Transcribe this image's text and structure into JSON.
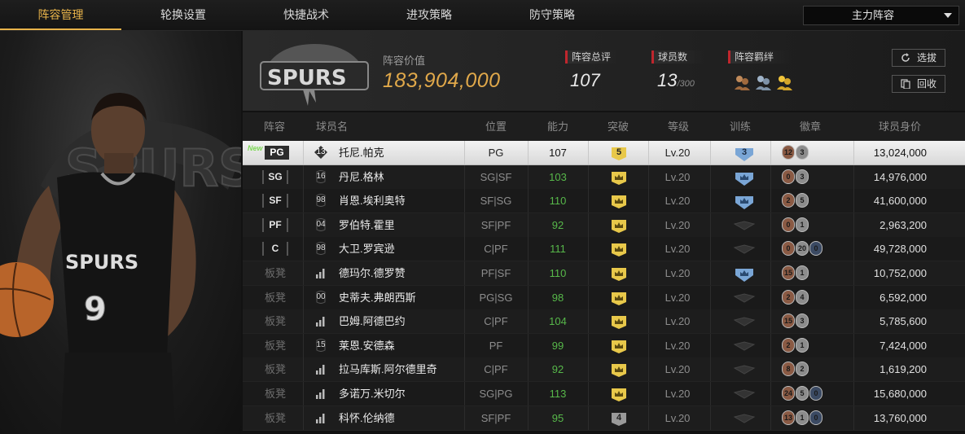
{
  "nav": {
    "tabs": [
      "阵容管理",
      "轮换设置",
      "快捷战术",
      "进攻策略",
      "防守策略"
    ],
    "active_tab": "阵容管理",
    "lineup_select": "主力阵容"
  },
  "team": {
    "logo_text": "SPURS",
    "value_label": "阵容价值",
    "value": "183,904,000",
    "rating_label": "阵容总评",
    "rating": "107",
    "player_count_label": "球员数",
    "player_count": "13",
    "player_count_max": "/300",
    "chemistry_label": "阵容羁绊",
    "chemistry_icons": [
      "chemistry-bronze-icon",
      "chemistry-silver-icon",
      "chemistry-gold-icon"
    ],
    "select_button": "选拔",
    "recycle_button": "回收"
  },
  "table": {
    "headers": [
      "阵容",
      "球员名",
      "位置",
      "能力",
      "突破",
      "等级",
      "训练",
      "徽章",
      "球员身价"
    ],
    "rows": [
      {
        "slot": "PG",
        "is_new": true,
        "new_label": "New",
        "num": "13",
        "name": "托尼.帕克",
        "pos": "PG",
        "ability": "107",
        "breakthrough": "5",
        "level": "Lv.20",
        "train": "3",
        "badges": [
          "12",
          "3"
        ],
        "price": "13,024,000"
      },
      {
        "slot": "SG",
        "num": "16",
        "name": "丹尼.格林",
        "pos": "SG|SF",
        "ability": "103",
        "breakthrough": "crown",
        "level": "Lv.20",
        "train": "crown",
        "badges": [
          "0",
          "3"
        ],
        "price": "14,976,000"
      },
      {
        "slot": "SF",
        "num": "98",
        "name": "肖恩.埃利奥特",
        "pos": "SF|SG",
        "ability": "110",
        "breakthrough": "crown",
        "level": "Lv.20",
        "train": "crown",
        "badges": [
          "2",
          "5"
        ],
        "price": "41,600,000"
      },
      {
        "slot": "PF",
        "num": "04",
        "name": "罗伯特.霍里",
        "pos": "SF|PF",
        "ability": "92",
        "breakthrough": "crown",
        "level": "Lv.20",
        "train": "none",
        "badges": [
          "0",
          "1"
        ],
        "price": "2,963,200"
      },
      {
        "slot": "C",
        "num": "98",
        "name": "大卫.罗宾逊",
        "pos": "C|PF",
        "ability": "111",
        "breakthrough": "crown",
        "level": "Lv.20",
        "train": "none",
        "badges": [
          "0",
          "20",
          "0"
        ],
        "price": "49,728,000"
      },
      {
        "slot": "板凳",
        "num": "",
        "name": "德玛尔.德罗赞",
        "pos": "PF|SF",
        "ability": "110",
        "breakthrough": "crown",
        "level": "Lv.20",
        "train": "crown",
        "badges": [
          "15",
          "1"
        ],
        "price": "10,752,000"
      },
      {
        "slot": "板凳",
        "num": "00",
        "name": "史蒂夫.弗朗西斯",
        "pos": "PG|SG",
        "ability": "98",
        "breakthrough": "crown",
        "level": "Lv.20",
        "train": "none",
        "badges": [
          "2",
          "4"
        ],
        "price": "6,592,000"
      },
      {
        "slot": "板凳",
        "num": "",
        "name": "巴姆.阿德巴约",
        "pos": "C|PF",
        "ability": "104",
        "breakthrough": "crown",
        "level": "Lv.20",
        "train": "none",
        "badges": [
          "15",
          "3"
        ],
        "price": "5,785,600"
      },
      {
        "slot": "板凳",
        "num": "15",
        "name": "莱恩.安德森",
        "pos": "PF",
        "ability": "99",
        "breakthrough": "crown",
        "level": "Lv.20",
        "train": "none",
        "badges": [
          "2",
          "1"
        ],
        "price": "7,424,000"
      },
      {
        "slot": "板凳",
        "num": "",
        "name": "拉马库斯.阿尔德里奇",
        "pos": "C|PF",
        "ability": "92",
        "breakthrough": "crown",
        "level": "Lv.20",
        "train": "none",
        "badges": [
          "8",
          "2"
        ],
        "price": "1,619,200"
      },
      {
        "slot": "板凳",
        "num": "",
        "name": "多诺万.米切尔",
        "pos": "SG|PG",
        "ability": "113",
        "breakthrough": "crown",
        "level": "Lv.20",
        "train": "none",
        "badges": [
          "24",
          "5",
          "0"
        ],
        "price": "15,680,000"
      },
      {
        "slot": "板凳",
        "num": "",
        "name": "科怀.伦纳德",
        "pos": "SF|PF",
        "ability": "95",
        "breakthrough": "4",
        "level": "Lv.20",
        "train": "none",
        "badges": [
          "13",
          "1",
          "0"
        ],
        "price": "13,760,000"
      }
    ]
  },
  "colors": {
    "accent": "#e8b34a",
    "ability_green": "#57b84a",
    "red_marker": "#c0262d"
  }
}
